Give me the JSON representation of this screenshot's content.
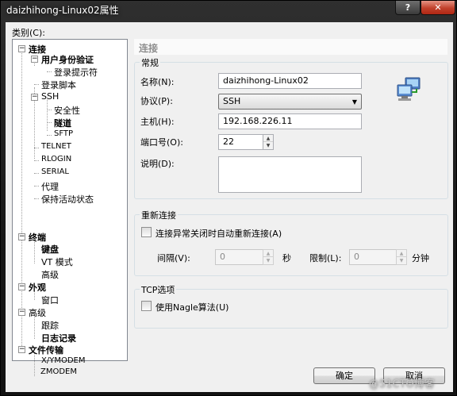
{
  "window": {
    "title": "daizhihong-Linux02属性",
    "help_label": "?",
    "close_label": "✕"
  },
  "category": {
    "label": "类别(C):",
    "tree": {
      "connection": "连接",
      "user_auth": "用户身份验证",
      "login_prompt": "登录提示符",
      "login_script": "登录脚本",
      "ssh": "SSH",
      "security": "安全性",
      "tunnel": "隧道",
      "sftp": "SFTP",
      "telnet": "TELNET",
      "rlogin": "RLOGIN",
      "serial": "SERIAL",
      "proxy": "代理",
      "keepalive": "保持活动状态",
      "terminal": "终端",
      "keyboard": "键盘",
      "vt_mode": "VT 模式",
      "term_advanced": "高级",
      "appearance": "外观",
      "window": "窗口",
      "advanced": "高级",
      "trace": "跟踪",
      "log": "日志记录",
      "file_transfer": "文件传输",
      "xymodem": "X/YMODEM",
      "zmodem": "ZMODEM"
    }
  },
  "panel": {
    "header": "连接",
    "general": {
      "title": "常规",
      "name_label": "名称(N):",
      "name_value": "daizhihong-Linux02",
      "protocol_label": "协议(P):",
      "protocol_value": "SSH",
      "host_label": "主机(H):",
      "host_value": "192.168.226.11",
      "port_label": "端口号(O):",
      "port_value": "22",
      "desc_label": "说明(D):",
      "desc_value": ""
    },
    "reconnect": {
      "title": "重新连接",
      "auto_reconnect_label": "连接异常关闭时自动重新连接(A)",
      "interval_label": "间隔(V):",
      "interval_value": "0",
      "sec_label": "秒",
      "limit_label": "限制(L):",
      "limit_value": "0",
      "min_label": "分钟"
    },
    "tcp": {
      "title": "TCP选项",
      "nagle_label": "使用Nagle算法(U)"
    }
  },
  "buttons": {
    "ok": "确定",
    "cancel": "取消"
  },
  "watermark": "@51CTO博客",
  "colors": {
    "titlebar": "#1e1e1e",
    "close": "#c0402b",
    "client_bg": "#f0f0f0"
  }
}
